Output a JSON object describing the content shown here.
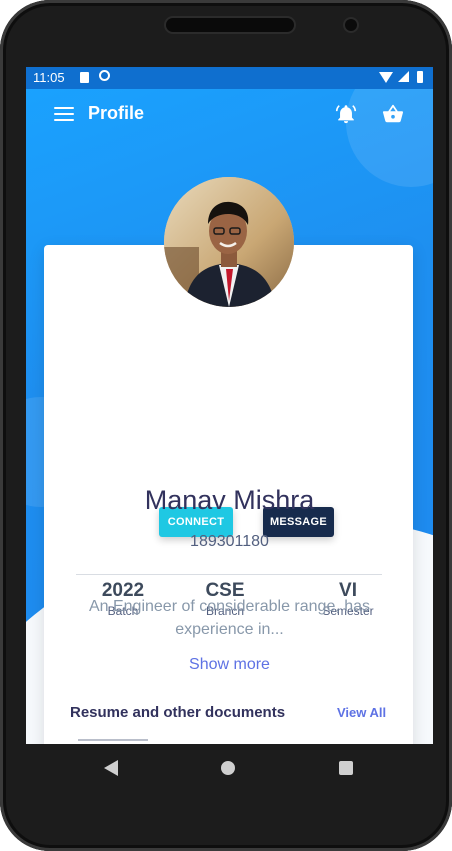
{
  "status_bar": {
    "time": "11:05"
  },
  "app_bar": {
    "title": "Profile"
  },
  "profile": {
    "connect_label": "CONNECT",
    "message_label": "MESSAGE",
    "stats": [
      {
        "value": "2022",
        "label": "Batch"
      },
      {
        "value": "CSE",
        "label": "Branch"
      },
      {
        "value": "VI",
        "label": "Semester"
      }
    ],
    "name": "Manav Mishra",
    "roll_number": "189301180",
    "bio": "An Engineer of considerable range, has experience in...",
    "show_more_label": "Show more"
  },
  "documents": {
    "title": "Resume and other documents",
    "view_all_label": "View All"
  },
  "icons": {
    "menu": "menu-icon",
    "bell": "bell-icon",
    "basket": "basket-icon"
  },
  "colors": {
    "header_blue": "#1e8ff0",
    "connect": "#1fc8e3",
    "message": "#172b4d",
    "link": "#5e72e4"
  }
}
